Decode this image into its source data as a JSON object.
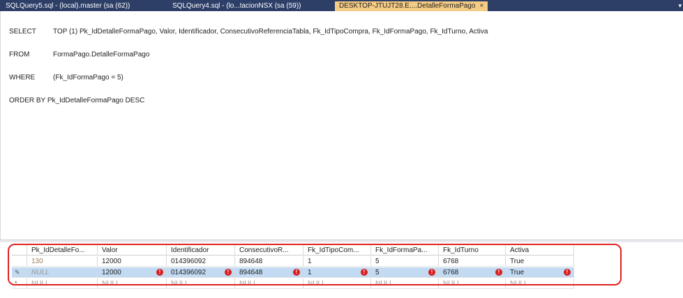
{
  "tabs": [
    {
      "label": "SQLQuery5.sql - (local).master (sa (62))",
      "active": false
    },
    {
      "label": "SQLQuery4.sql - (lo...tacionNSX (sa (59))",
      "active": false
    },
    {
      "label": "DESKTOP-JTUJT28.E....DetalleFormaPago",
      "active": true
    }
  ],
  "tab_close": "×",
  "tab_dropdown": "▾",
  "query": {
    "lines": [
      {
        "kw": "SELECT",
        "text": "TOP (1) Pk_IdDetalleFormaPago, Valor, Identificador, ConsecutivoReferenciaTabla, Fk_IdTipoCompra, Fk_IdFormaPago, Fk_IdTurno, Activa"
      },
      {
        "kw": "FROM",
        "text": "FormaPago.DetalleFormaPago"
      },
      {
        "kw": "WHERE",
        "text": "(Fk_IdFormaPago = 5)"
      },
      {
        "kw": "ORDER BY",
        "text": "Pk_IdDetalleFormaPago DESC"
      }
    ]
  },
  "results": {
    "columns": [
      "Pk_IdDetalleFo...",
      "Valor",
      "Identificador",
      "ConsecutivoR...",
      "Fk_IdTipoCom...",
      "Fk_IdFormaPa...",
      "Fk_IdTurno",
      "Activa"
    ],
    "rows": [
      [
        "130",
        "12000",
        "014396092",
        "894648",
        "1",
        "5",
        "6768",
        "True"
      ],
      [
        "NULL",
        "12000",
        "014396092",
        "894648",
        "1",
        "5",
        "6768",
        "True"
      ],
      [
        "NULL",
        "NULL",
        "NULL",
        "NULL",
        "NULL",
        "NULL",
        "NULL",
        "NULL"
      ]
    ],
    "row_markers": [
      "",
      "✎",
      "*"
    ],
    "error_icon": "!",
    "highlight_color": "#e02020",
    "selected_row_color": "#c2daf2"
  }
}
